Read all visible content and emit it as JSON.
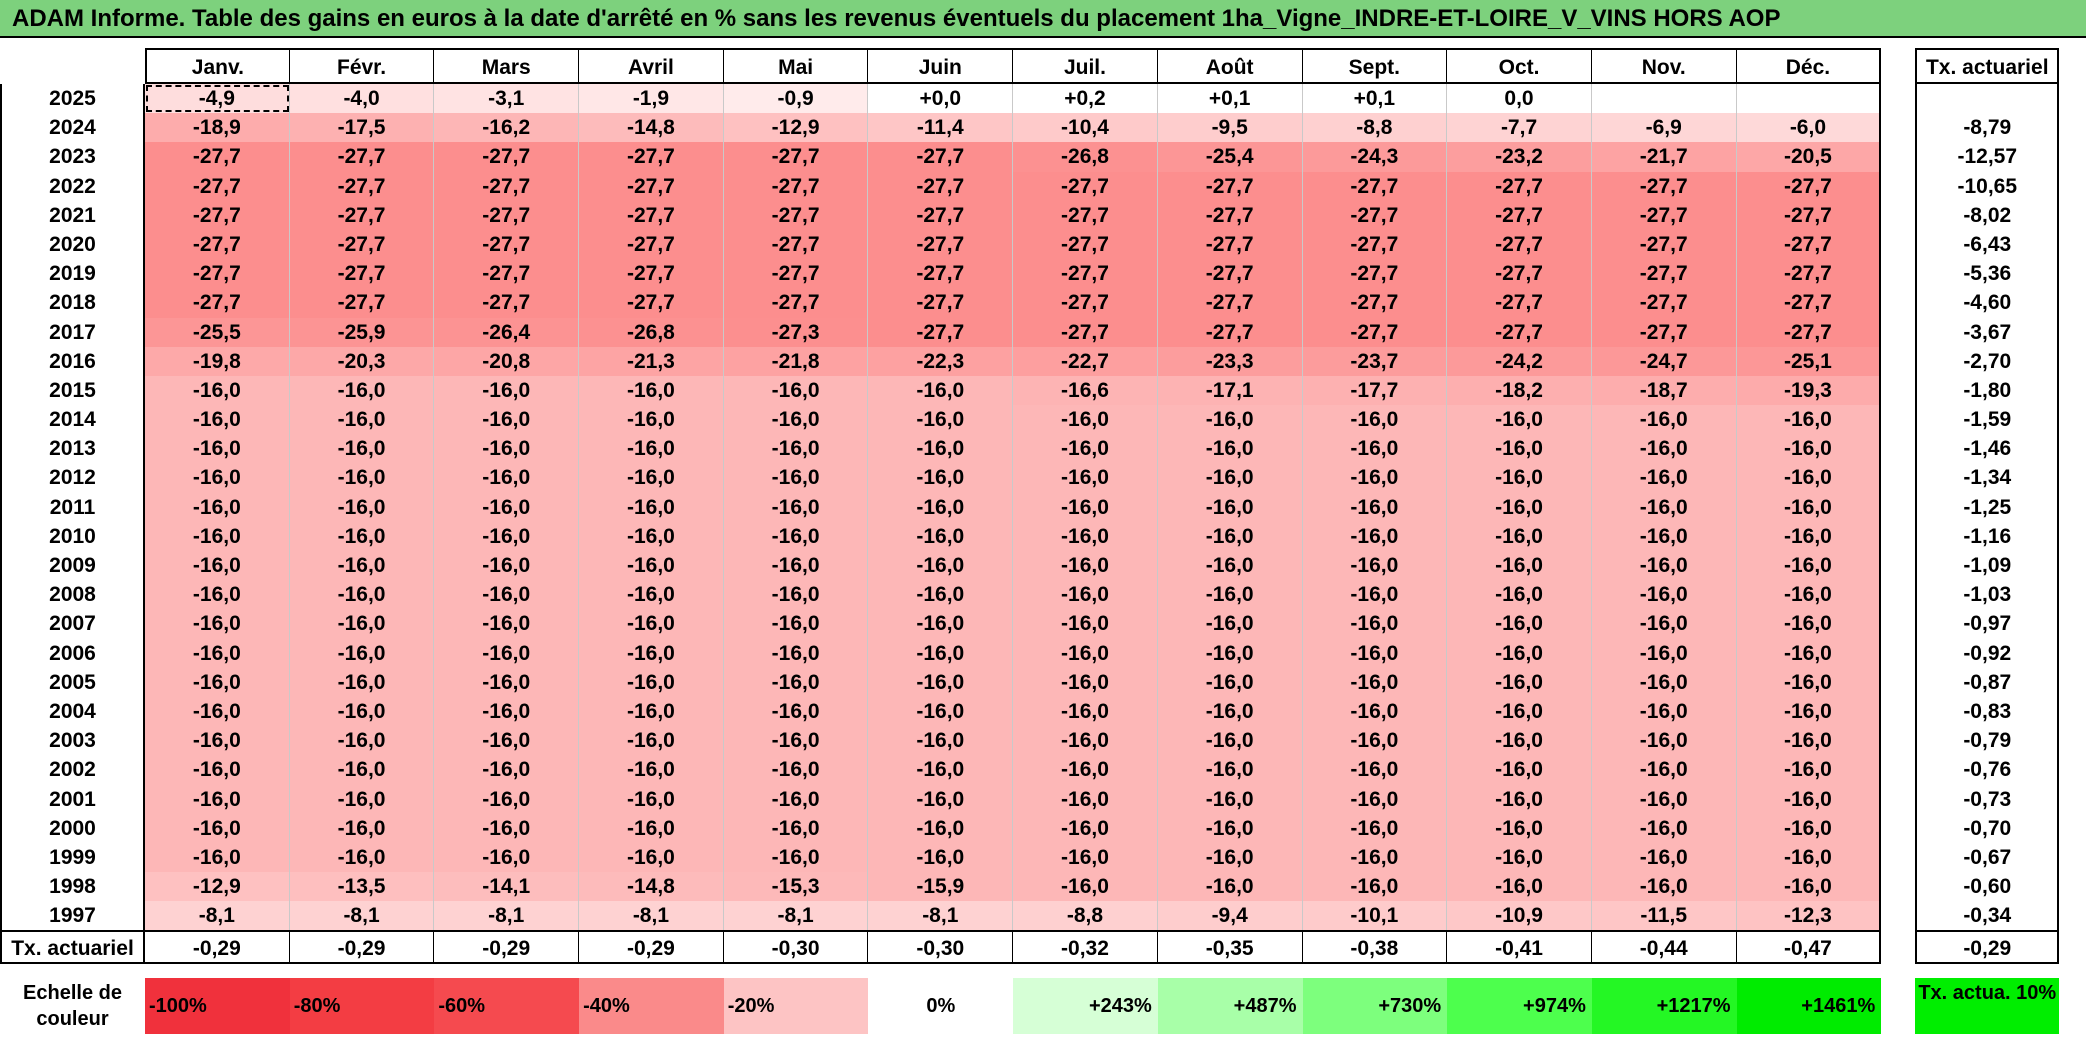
{
  "title": "ADAM Informe. Table des gains en euros à la date d'arrêté en % sans les revenus éventuels du placement 1ha_Vigne_INDRE-ET-LOIRE_V_VINS HORS AOP",
  "months": [
    "Janv.",
    "Févr.",
    "Mars",
    "Avril",
    "Mai",
    "Juin",
    "Juil.",
    "Août",
    "Sept.",
    "Oct.",
    "Nov.",
    "Déc."
  ],
  "ta_header": "Tx. actuariel",
  "rows": [
    {
      "year": "2025",
      "values": [
        "-4,9",
        "-4,0",
        "-3,1",
        "-1,9",
        "-0,9",
        "+0,0",
        "+0,2",
        "+0,1",
        "+0,1",
        "0,0",
        "",
        ""
      ],
      "ta": ""
    },
    {
      "year": "2024",
      "values": [
        "-18,9",
        "-17,5",
        "-16,2",
        "-14,8",
        "-12,9",
        "-11,4",
        "-10,4",
        "-9,5",
        "-8,8",
        "-7,7",
        "-6,9",
        "-6,0"
      ],
      "ta": "-8,79"
    },
    {
      "year": "2023",
      "values": [
        "-27,7",
        "-27,7",
        "-27,7",
        "-27,7",
        "-27,7",
        "-27,7",
        "-26,8",
        "-25,4",
        "-24,3",
        "-23,2",
        "-21,7",
        "-20,5"
      ],
      "ta": "-12,57"
    },
    {
      "year": "2022",
      "values": [
        "-27,7",
        "-27,7",
        "-27,7",
        "-27,7",
        "-27,7",
        "-27,7",
        "-27,7",
        "-27,7",
        "-27,7",
        "-27,7",
        "-27,7",
        "-27,7"
      ],
      "ta": "-10,65"
    },
    {
      "year": "2021",
      "values": [
        "-27,7",
        "-27,7",
        "-27,7",
        "-27,7",
        "-27,7",
        "-27,7",
        "-27,7",
        "-27,7",
        "-27,7",
        "-27,7",
        "-27,7",
        "-27,7"
      ],
      "ta": "-8,02"
    },
    {
      "year": "2020",
      "values": [
        "-27,7",
        "-27,7",
        "-27,7",
        "-27,7",
        "-27,7",
        "-27,7",
        "-27,7",
        "-27,7",
        "-27,7",
        "-27,7",
        "-27,7",
        "-27,7"
      ],
      "ta": "-6,43"
    },
    {
      "year": "2019",
      "values": [
        "-27,7",
        "-27,7",
        "-27,7",
        "-27,7",
        "-27,7",
        "-27,7",
        "-27,7",
        "-27,7",
        "-27,7",
        "-27,7",
        "-27,7",
        "-27,7"
      ],
      "ta": "-5,36"
    },
    {
      "year": "2018",
      "values": [
        "-27,7",
        "-27,7",
        "-27,7",
        "-27,7",
        "-27,7",
        "-27,7",
        "-27,7",
        "-27,7",
        "-27,7",
        "-27,7",
        "-27,7",
        "-27,7"
      ],
      "ta": "-4,60"
    },
    {
      "year": "2017",
      "values": [
        "-25,5",
        "-25,9",
        "-26,4",
        "-26,8",
        "-27,3",
        "-27,7",
        "-27,7",
        "-27,7",
        "-27,7",
        "-27,7",
        "-27,7",
        "-27,7"
      ],
      "ta": "-3,67"
    },
    {
      "year": "2016",
      "values": [
        "-19,8",
        "-20,3",
        "-20,8",
        "-21,3",
        "-21,8",
        "-22,3",
        "-22,7",
        "-23,3",
        "-23,7",
        "-24,2",
        "-24,7",
        "-25,1"
      ],
      "ta": "-2,70"
    },
    {
      "year": "2015",
      "values": [
        "-16,0",
        "-16,0",
        "-16,0",
        "-16,0",
        "-16,0",
        "-16,0",
        "-16,6",
        "-17,1",
        "-17,7",
        "-18,2",
        "-18,7",
        "-19,3"
      ],
      "ta": "-1,80"
    },
    {
      "year": "2014",
      "values": [
        "-16,0",
        "-16,0",
        "-16,0",
        "-16,0",
        "-16,0",
        "-16,0",
        "-16,0",
        "-16,0",
        "-16,0",
        "-16,0",
        "-16,0",
        "-16,0"
      ],
      "ta": "-1,59"
    },
    {
      "year": "2013",
      "values": [
        "-16,0",
        "-16,0",
        "-16,0",
        "-16,0",
        "-16,0",
        "-16,0",
        "-16,0",
        "-16,0",
        "-16,0",
        "-16,0",
        "-16,0",
        "-16,0"
      ],
      "ta": "-1,46"
    },
    {
      "year": "2012",
      "values": [
        "-16,0",
        "-16,0",
        "-16,0",
        "-16,0",
        "-16,0",
        "-16,0",
        "-16,0",
        "-16,0",
        "-16,0",
        "-16,0",
        "-16,0",
        "-16,0"
      ],
      "ta": "-1,34"
    },
    {
      "year": "2011",
      "values": [
        "-16,0",
        "-16,0",
        "-16,0",
        "-16,0",
        "-16,0",
        "-16,0",
        "-16,0",
        "-16,0",
        "-16,0",
        "-16,0",
        "-16,0",
        "-16,0"
      ],
      "ta": "-1,25"
    },
    {
      "year": "2010",
      "values": [
        "-16,0",
        "-16,0",
        "-16,0",
        "-16,0",
        "-16,0",
        "-16,0",
        "-16,0",
        "-16,0",
        "-16,0",
        "-16,0",
        "-16,0",
        "-16,0"
      ],
      "ta": "-1,16"
    },
    {
      "year": "2009",
      "values": [
        "-16,0",
        "-16,0",
        "-16,0",
        "-16,0",
        "-16,0",
        "-16,0",
        "-16,0",
        "-16,0",
        "-16,0",
        "-16,0",
        "-16,0",
        "-16,0"
      ],
      "ta": "-1,09"
    },
    {
      "year": "2008",
      "values": [
        "-16,0",
        "-16,0",
        "-16,0",
        "-16,0",
        "-16,0",
        "-16,0",
        "-16,0",
        "-16,0",
        "-16,0",
        "-16,0",
        "-16,0",
        "-16,0"
      ],
      "ta": "-1,03"
    },
    {
      "year": "2007",
      "values": [
        "-16,0",
        "-16,0",
        "-16,0",
        "-16,0",
        "-16,0",
        "-16,0",
        "-16,0",
        "-16,0",
        "-16,0",
        "-16,0",
        "-16,0",
        "-16,0"
      ],
      "ta": "-0,97"
    },
    {
      "year": "2006",
      "values": [
        "-16,0",
        "-16,0",
        "-16,0",
        "-16,0",
        "-16,0",
        "-16,0",
        "-16,0",
        "-16,0",
        "-16,0",
        "-16,0",
        "-16,0",
        "-16,0"
      ],
      "ta": "-0,92"
    },
    {
      "year": "2005",
      "values": [
        "-16,0",
        "-16,0",
        "-16,0",
        "-16,0",
        "-16,0",
        "-16,0",
        "-16,0",
        "-16,0",
        "-16,0",
        "-16,0",
        "-16,0",
        "-16,0"
      ],
      "ta": "-0,87"
    },
    {
      "year": "2004",
      "values": [
        "-16,0",
        "-16,0",
        "-16,0",
        "-16,0",
        "-16,0",
        "-16,0",
        "-16,0",
        "-16,0",
        "-16,0",
        "-16,0",
        "-16,0",
        "-16,0"
      ],
      "ta": "-0,83"
    },
    {
      "year": "2003",
      "values": [
        "-16,0",
        "-16,0",
        "-16,0",
        "-16,0",
        "-16,0",
        "-16,0",
        "-16,0",
        "-16,0",
        "-16,0",
        "-16,0",
        "-16,0",
        "-16,0"
      ],
      "ta": "-0,79"
    },
    {
      "year": "2002",
      "values": [
        "-16,0",
        "-16,0",
        "-16,0",
        "-16,0",
        "-16,0",
        "-16,0",
        "-16,0",
        "-16,0",
        "-16,0",
        "-16,0",
        "-16,0",
        "-16,0"
      ],
      "ta": "-0,76"
    },
    {
      "year": "2001",
      "values": [
        "-16,0",
        "-16,0",
        "-16,0",
        "-16,0",
        "-16,0",
        "-16,0",
        "-16,0",
        "-16,0",
        "-16,0",
        "-16,0",
        "-16,0",
        "-16,0"
      ],
      "ta": "-0,73"
    },
    {
      "year": "2000",
      "values": [
        "-16,0",
        "-16,0",
        "-16,0",
        "-16,0",
        "-16,0",
        "-16,0",
        "-16,0",
        "-16,0",
        "-16,0",
        "-16,0",
        "-16,0",
        "-16,0"
      ],
      "ta": "-0,70"
    },
    {
      "year": "1999",
      "values": [
        "-16,0",
        "-16,0",
        "-16,0",
        "-16,0",
        "-16,0",
        "-16,0",
        "-16,0",
        "-16,0",
        "-16,0",
        "-16,0",
        "-16,0",
        "-16,0"
      ],
      "ta": "-0,67"
    },
    {
      "year": "1998",
      "values": [
        "-12,9",
        "-13,5",
        "-14,1",
        "-14,8",
        "-15,3",
        "-15,9",
        "-16,0",
        "-16,0",
        "-16,0",
        "-16,0",
        "-16,0",
        "-16,0"
      ],
      "ta": "-0,60"
    },
    {
      "year": "1997",
      "values": [
        "-8,1",
        "-8,1",
        "-8,1",
        "-8,1",
        "-8,1",
        "-8,1",
        "-8,8",
        "-9,4",
        "-10,1",
        "-10,9",
        "-11,5",
        "-12,3"
      ],
      "ta": "-0,34"
    }
  ],
  "footer": {
    "label": "Tx. actuariel",
    "values": [
      "-0,29",
      "-0,29",
      "-0,29",
      "-0,29",
      "-0,30",
      "-0,30",
      "-0,32",
      "-0,35",
      "-0,38",
      "-0,41",
      "-0,44",
      "-0,47"
    ],
    "ta": "-0,29"
  },
  "scale": {
    "label": "Echelle de couleur",
    "items": [
      {
        "label": "-100%",
        "color": "#f0313c"
      },
      {
        "label": "-80%",
        "color": "#f33d43"
      },
      {
        "label": "-60%",
        "color": "#f54a4f"
      },
      {
        "label": "-40%",
        "color": "#fa8a8a"
      },
      {
        "label": "-20%",
        "color": "#fdc4c4"
      },
      {
        "label": "0%",
        "color": "#ffffff"
      },
      {
        "label": "+243%",
        "color": "#d6ffd6"
      },
      {
        "label": "+487%",
        "color": "#a8ffa8"
      },
      {
        "label": "+730%",
        "color": "#7dff7d"
      },
      {
        "label": "+974%",
        "color": "#4dff4d"
      },
      {
        "label": "+1217%",
        "color": "#24f724"
      },
      {
        "label": "+1461%",
        "color": "#00ec00"
      }
    ],
    "ta_label": "Tx. actua. 10%",
    "ta_color": "#00ee00"
  }
}
